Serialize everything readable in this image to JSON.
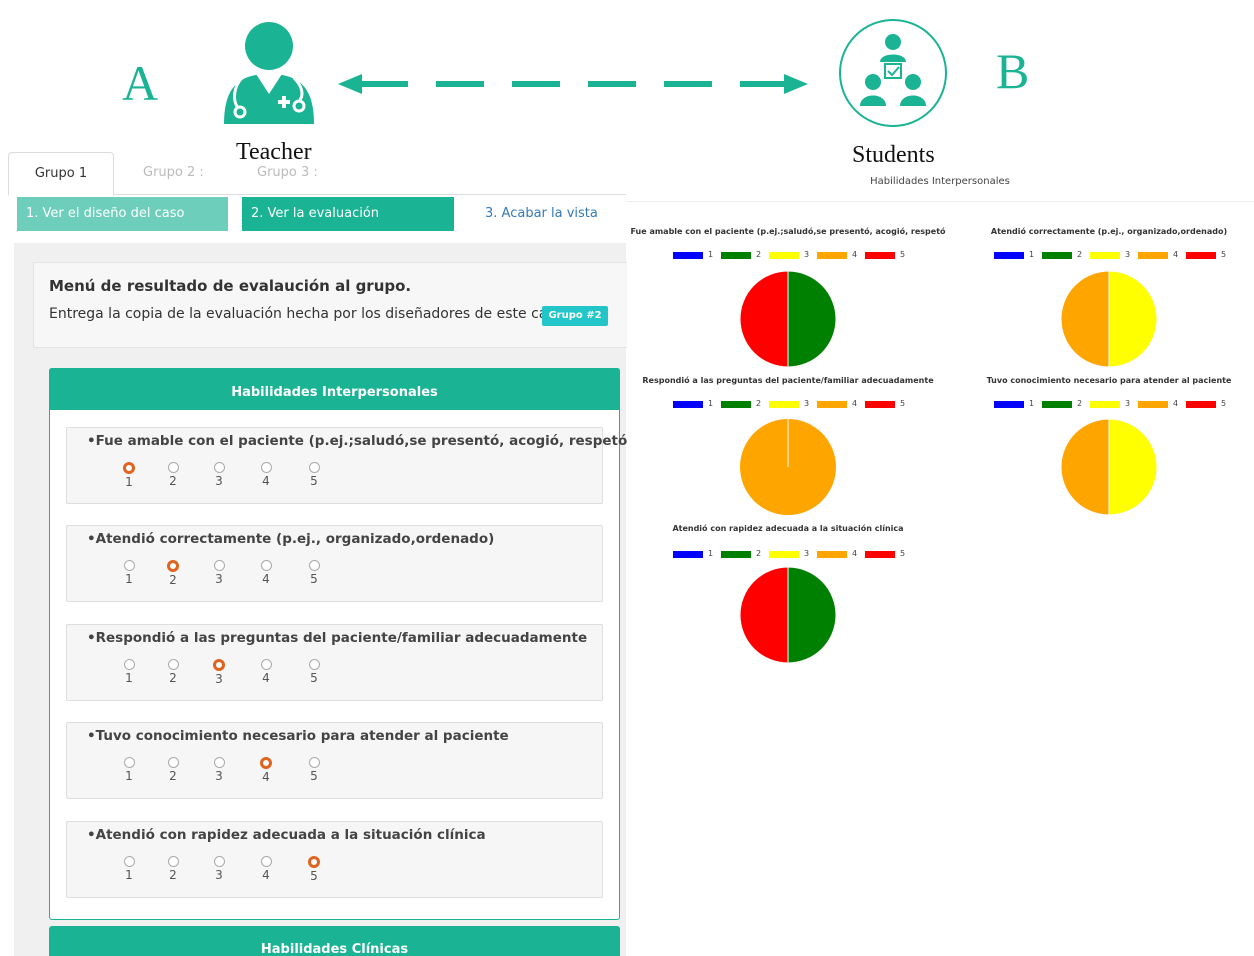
{
  "banner": {
    "letter_a": "A",
    "letter_b": "B",
    "teacher_label": "Teacher",
    "students_label": "Students",
    "accent": "#1ab394",
    "teacher_icon": "doctor-icon",
    "students_icon": "students-group-icon"
  },
  "tabs": [
    {
      "label": "Grupo 1",
      "active": true
    },
    {
      "label": "Grupo 2 :",
      "active": false
    },
    {
      "label": "Grupo 3 :",
      "active": false
    }
  ],
  "steps": {
    "step1": "1. Ver el diseño del caso",
    "step2": "2. Ver la evaluación",
    "step3": "3. Acabar la vista"
  },
  "menu": {
    "title": "Menú de resultado de evalaución al grupo.",
    "text": "Entrega la copia de la evaluación hecha por los diseñadores de este caso, al",
    "badge": "Grupo #2"
  },
  "section": {
    "title": "Habilidades Interpersonales",
    "next_title": "Habilidades Clínicas",
    "options": [
      "1",
      "2",
      "3",
      "4",
      "5"
    ],
    "questions": [
      {
        "label": "•Fue amable con el paciente (p.ej.;saludó,se presentó, acogió, respetó",
        "selected": 1
      },
      {
        "label": "•Atendió correctamente (p.ej., organizado,ordenado)",
        "selected": 2
      },
      {
        "label": "•Respondió a las preguntas del paciente/familiar adecuadamente",
        "selected": 3
      },
      {
        "label": "•Tuvo conocimiento necesario para atender al paciente",
        "selected": 4
      },
      {
        "label": "•Atendió con rapidez adecuada a la situación clínica",
        "selected": 5
      }
    ]
  },
  "charts_title": "Habilidades Interpersonales",
  "legend": [
    {
      "label": "1",
      "color": "#0000ff"
    },
    {
      "label": "2",
      "color": "#008000"
    },
    {
      "label": "3",
      "color": "#ffff00"
    },
    {
      "label": "4",
      "color": "#ffa500"
    },
    {
      "label": "5",
      "color": "#ff0000"
    }
  ],
  "chart_data": [
    {
      "type": "pie",
      "title": "Fue amable con el paciente (p.ej.;saludó,se presentó, acogió, respetó",
      "categories": [
        "1",
        "2",
        "3",
        "4",
        "5"
      ],
      "values": [
        0,
        1,
        0,
        0,
        1
      ]
    },
    {
      "type": "pie",
      "title": "Atendió correctamente (p.ej., organizado,ordenado)",
      "categories": [
        "1",
        "2",
        "3",
        "4",
        "5"
      ],
      "values": [
        0,
        0,
        1,
        1,
        0
      ]
    },
    {
      "type": "pie",
      "title": "Respondió a las preguntas del paciente/familiar adecuadamente",
      "categories": [
        "1",
        "2",
        "3",
        "4",
        "5"
      ],
      "values": [
        0,
        0,
        0,
        1,
        0
      ]
    },
    {
      "type": "pie",
      "title": "Tuvo conocimiento necesario para atender al paciente",
      "categories": [
        "1",
        "2",
        "3",
        "4",
        "5"
      ],
      "values": [
        0,
        0,
        1,
        1,
        0
      ]
    },
    {
      "type": "pie",
      "title": "Atendió con rapidez adecuada a la situación clínica",
      "categories": [
        "1",
        "2",
        "3",
        "4",
        "5"
      ],
      "values": [
        0,
        1,
        0,
        0,
        1
      ]
    }
  ]
}
